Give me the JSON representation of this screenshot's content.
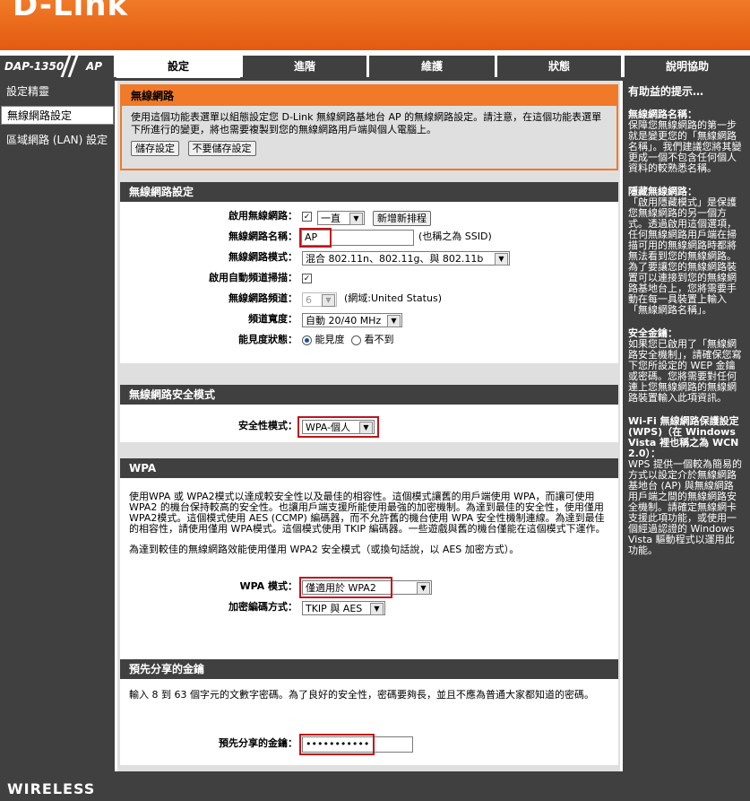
{
  "brand": "D-Link",
  "model": {
    "name": "DAP-1350",
    "mode": "AP"
  },
  "tabs": [
    "設定",
    "進階",
    "維護",
    "狀態",
    "說明協助"
  ],
  "leftnav": [
    "設定精靈",
    "無線網路設定",
    "區域網路 (LAN) 設定"
  ],
  "intro": {
    "title": "無線網路",
    "text": "使用這個功能表選單以組態設定您 D-Link 無線網路基地台 AP 的無線網路設定。請注意，在這個功能表選單下所進行的變更，將也需要複製到您的無線網路用戶端與個人電腦上。",
    "save": "儲存設定",
    "nosave": "不要儲存設定"
  },
  "wireless": {
    "title": "無線網路設定",
    "enable_label": "啟用無線網路：",
    "schedule": "一直",
    "new_schedule": "新增新排程",
    "name_label": "無線網路名稱：",
    "name_value": "AP",
    "ssid_note": "(也稱之為 SSID)",
    "mode_label": "無線網路模式：",
    "mode_value": "混合 802.11n、802.11g、與 802.11b",
    "auto_label": "啟用自動頻道掃描：",
    "channel_label": "無線網路頻道：",
    "channel_value": "6",
    "domain_note": "(網域:United Status)",
    "width_label": "頻道寬度：",
    "width_value": "自動 20/40 MHz",
    "visible_label": "能見度狀態：",
    "visible_opt1": "能見度",
    "visible_opt2": "看不到"
  },
  "security": {
    "title": "無線網路安全模式",
    "mode_label": "安全性模式：",
    "mode_value": "WPA-個人"
  },
  "wpa": {
    "title": "WPA",
    "p1": "使用WPA 或 WPA2模式以達成較安全性以及最佳的相容性。這個模式讓舊的用戶端使用 WPA，而讓可使用 WPA2 的機台保持較高的安全性。也讓用戶端支援所能使用最強的加密機制。為達到最佳的安全性，使用僅用 WPA2模式。這個模式使用 AES (CCMP) 編碼器，而不允許舊的機台使用 WPA 安全性機制連線。為達到最佳的相容性，請使用僅用 WPA模式。這個模式使用 TKIP 編碼器。一些遊戲與舊的機台僅能在這個模式下運作。",
    "p2": "為達到較佳的無線網路效能使用僅用 WPA2 安全模式（或換句話說，以 AES 加密方式）。",
    "mode_label": "WPA 模式：",
    "mode_value": "僅適用於 WPA2",
    "cipher_label": "加密編碼方式：",
    "cipher_value": "TKIP 與 AES"
  },
  "psk": {
    "title": "預先分享的金鑰",
    "text": "輸入 8 到 63 個字元的文數字密碼。為了良好的安全性，密碼要夠長，並且不應為普通大家都知道的密碼。",
    "label": "預先分享的金鑰：",
    "value": "•••••••••••"
  },
  "help": {
    "title": "有助益的提示…",
    "h1": "無線網路名稱：",
    "t1": "保障您無線網路的第一步就是變更您的「無線網路名稱」。我們建議您將其變更成一個不包含任何個人資料的較熟悉名稱。",
    "h2": "隱藏無線網路：",
    "t2": "「啟用隱藏模式」是保護您無線網路的另一個方式。透過啟用這個選項，任何無線網路用戶端在掃描可用的無線網路時都將無法看到您的無線網路。為了要讓您的無線網路裝置可以連接到您的無線網路基地台上，您將需要手動在每一具裝置上輸入「無線網路名稱」。",
    "h3": "安全金鑰：",
    "t3": "如果您已啟用了「無線網路安全機制」，請確保您寫下您所設定的 WEP 金鑰或密碼。您將需要對任何連上您無線網路的無線網路裝置輸入此項資訊。",
    "h4": "Wi-Fi 無線網路保護設定 (WPS)（在 Windows Vista 裡也稱之為 WCN 2.0）：",
    "t4": "WPS 提供一個較為簡易的方式以設定介於無線網路基地台 (AP) 與無線網路用戶端之間的無線網路安全機制。請確定無線網卡支援此項功能，或使用一個經過認證的 Windows Vista 驅動程式以運用此功能。"
  },
  "footer": "WIRELESS"
}
